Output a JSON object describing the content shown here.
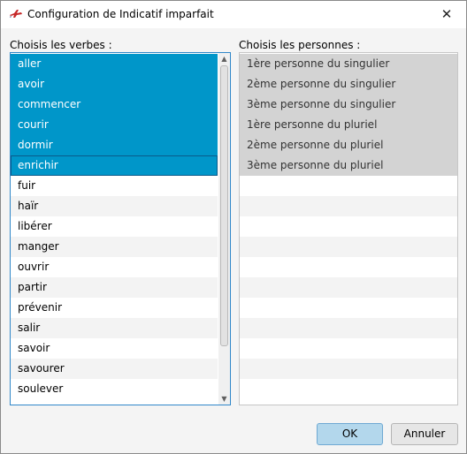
{
  "window": {
    "title": "Configuration de Indicatif imparfait",
    "close_glyph": "✕"
  },
  "verbs": {
    "label": "Choisis les verbes :",
    "items": [
      "aller",
      "avoir",
      "commencer",
      "courir",
      "dormir",
      "enrichir",
      "fuir",
      "haïr",
      "libérer",
      "manger",
      "ouvrir",
      "partir",
      "prévenir",
      "salir",
      "savoir",
      "savourer",
      "soulever"
    ],
    "selected": [
      "aller",
      "avoir",
      "commencer",
      "courir",
      "dormir",
      "enrichir"
    ],
    "focused": "enrichir"
  },
  "persons": {
    "label": "Choisis les personnes :",
    "items": [
      "1ère personne du singulier",
      "2ème personne du singulier",
      "3ème personne du singulier",
      "1ère personne du pluriel",
      "2ème personne du pluriel",
      "3ème personne du pluriel"
    ],
    "empty_rows": 11
  },
  "buttons": {
    "ok": "OK",
    "cancel": "Annuler"
  },
  "icons": {
    "app": "airplane-icon",
    "scroll_up": "▲",
    "scroll_down": "▼"
  },
  "colors": {
    "selection": "#0096c9",
    "disabled_selection": "#d3d3d3",
    "ok_button": "#b3d7ec"
  }
}
